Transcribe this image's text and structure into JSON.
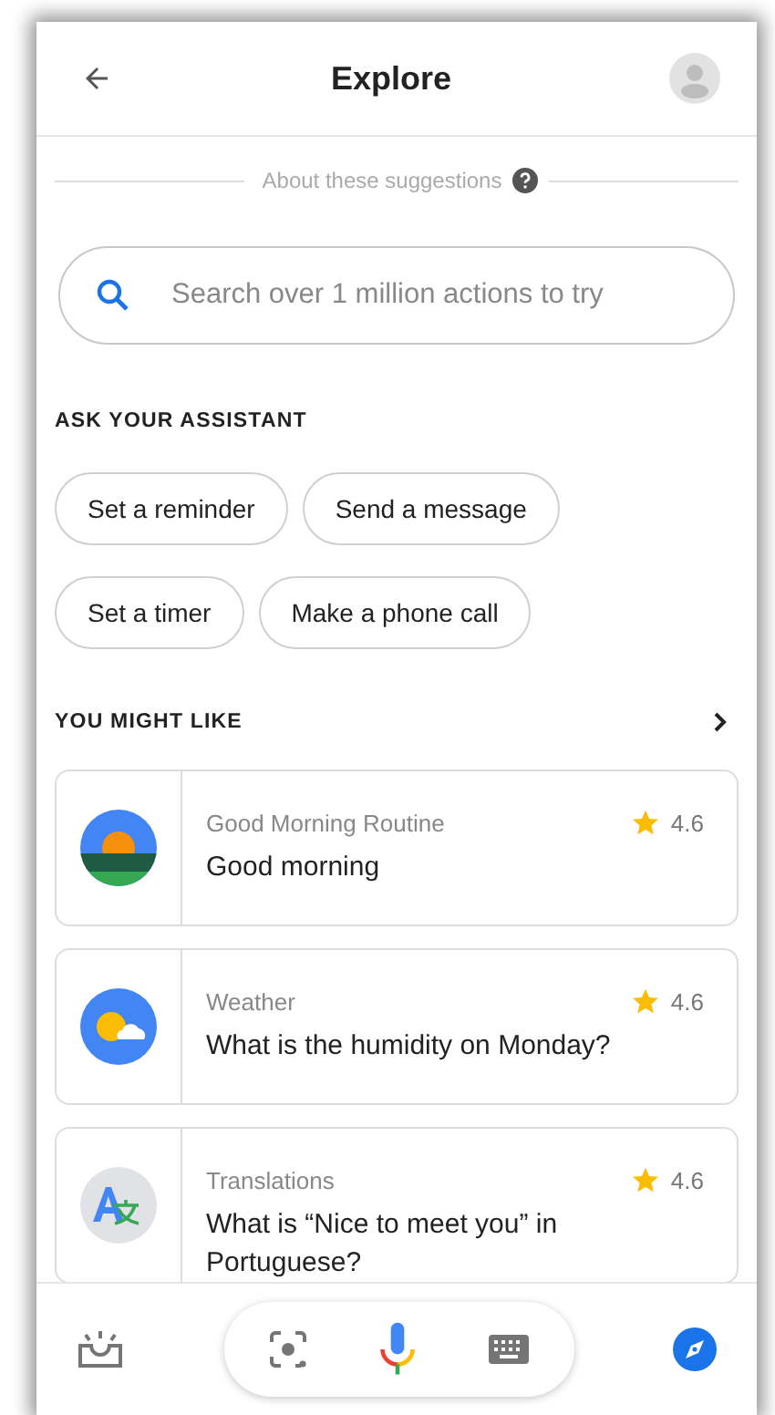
{
  "header": {
    "title": "Explore"
  },
  "about": {
    "label": "About these suggestions"
  },
  "search": {
    "placeholder": "Search over 1 million actions to try"
  },
  "ask_section": {
    "title": "ASK YOUR ASSISTANT",
    "chip_rows": [
      [
        "Set a reminder",
        "Send a message"
      ],
      [
        "Set a timer",
        "Make a phone call"
      ]
    ]
  },
  "like_section": {
    "title": "YOU MIGHT LIKE"
  },
  "cards": [
    {
      "category": "Good Morning Routine",
      "rating": "4.6",
      "query": "Good morning"
    },
    {
      "category": "Weather",
      "rating": "4.6",
      "query": "What is the humidity on Monday?"
    },
    {
      "category": "Translations",
      "rating": "4.6",
      "query": "What is “Nice to meet you” in Portuguese?"
    }
  ]
}
